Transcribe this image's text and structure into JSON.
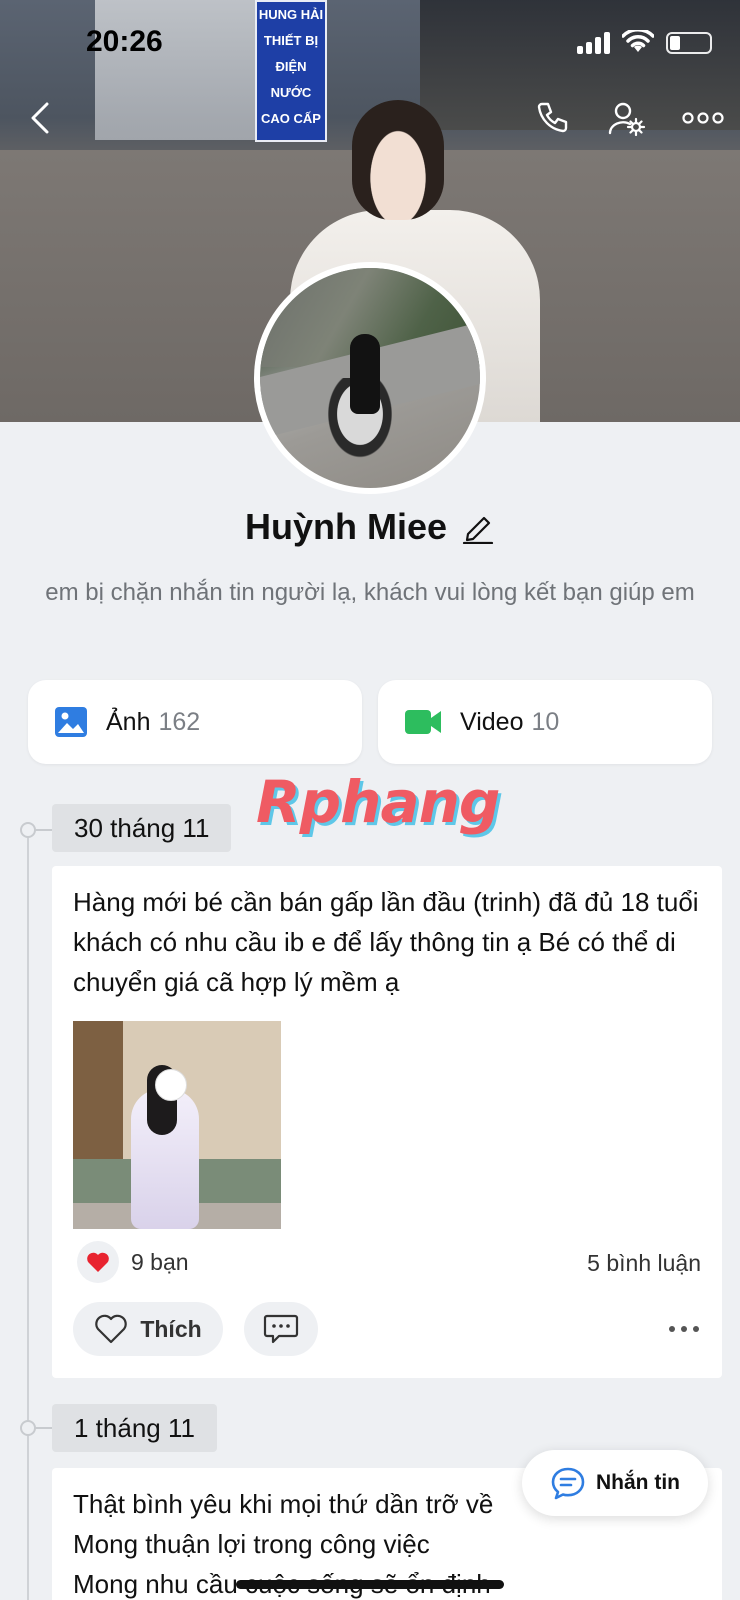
{
  "status_bar": {
    "time": "20:26"
  },
  "cover": {
    "sign_lines": [
      "HUNG HẢI",
      "THIẾT BỊ",
      "ĐIỆN NƯỚC",
      "CAO CẤP"
    ]
  },
  "profile": {
    "name": "Huỳnh Miee",
    "bio": "em bị chặn nhắn tin người lạ, khách vui lòng kết bạn giúp em"
  },
  "media": {
    "photos_label": "Ảnh",
    "photos_count": "162",
    "videos_label": "Video",
    "videos_count": "10"
  },
  "watermark": "Rphang",
  "timeline": [
    {
      "date": "30 tháng 11",
      "text": "Hàng mới bé cần bán gấp lần đầu (trinh) đã đủ 18 tuổi khách có nhu cầu ib e để lấy thông tin ạ Bé có thể di chuyển giá cã hợp lý mềm ạ",
      "reactions": "9 bạn",
      "comments": "5 bình luận",
      "like_label": "Thích"
    },
    {
      "date": "1 tháng 11",
      "text_lines": [
        "Thật bình yêu khi mọi thứ dần trỡ về",
        "Mong thuận lợi trong công việc",
        "Mong nhu cầu cuộc sống sẽ ổn định"
      ]
    }
  ],
  "fab": {
    "label": "Nhắn tin"
  },
  "colors": {
    "accent_blue": "#2f7de1",
    "video_green": "#2dbd5e",
    "heart_red": "#e8232f"
  }
}
